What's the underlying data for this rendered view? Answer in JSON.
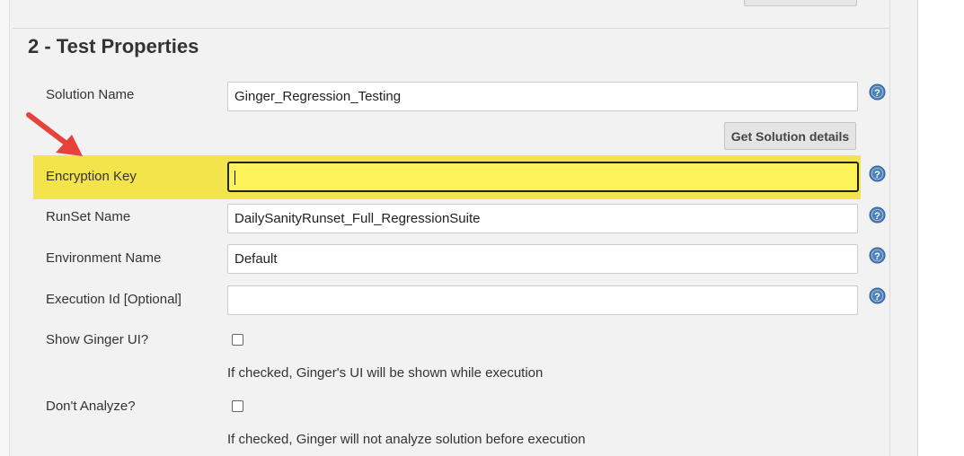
{
  "section": {
    "title": "2 - Test Properties"
  },
  "fields": {
    "solution_name": {
      "label": "Solution Name",
      "value": "Ginger_Regression_Testing"
    },
    "get_solution_button": "Get Solution details",
    "encryption_key": {
      "label": "Encryption Key",
      "value": ""
    },
    "runset_name": {
      "label": "RunSet Name",
      "value": "DailySanityRunset_Full_RegressionSuite"
    },
    "environment_name": {
      "label": "Environment Name",
      "value": "Default"
    },
    "execution_id": {
      "label": "Execution Id [Optional]",
      "value": ""
    },
    "show_ginger_ui": {
      "label": "Show Ginger UI?",
      "checked": false,
      "hint": "If checked, Ginger's UI will be shown while execution"
    },
    "dont_analyze": {
      "label": "Don't Analyze?",
      "checked": false,
      "hint": "If checked, Ginger will not analyze solution before execution"
    }
  },
  "colors": {
    "highlight": "#f2e44a",
    "arrow": "#e8413c",
    "help_icon": "#4a7fb8"
  },
  "icons": {
    "help": "help-icon",
    "annotation": "red-arrow-icon"
  }
}
